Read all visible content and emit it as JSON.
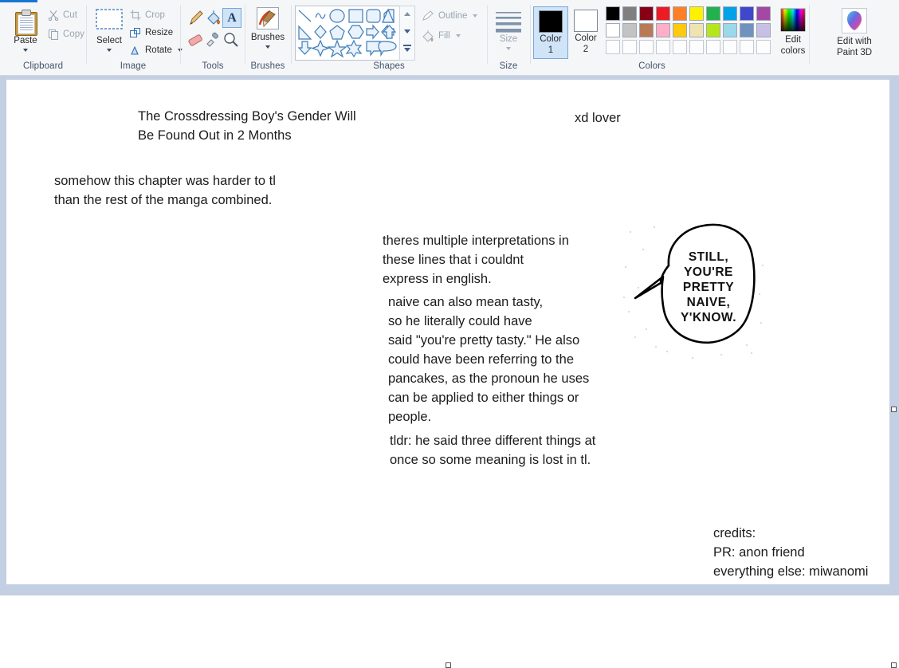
{
  "app": {
    "name": "Paint",
    "accent": "#1876d2"
  },
  "ribbon": {
    "groups": [
      {
        "id": "clipboard",
        "label": "Clipboard"
      },
      {
        "id": "image",
        "label": "Image"
      },
      {
        "id": "tools",
        "label": "Tools"
      },
      {
        "id": "brushes",
        "label": "Brushes"
      },
      {
        "id": "shapes",
        "label": "Shapes"
      },
      {
        "id": "size",
        "label": "Size"
      },
      {
        "id": "colors",
        "label": "Colors"
      }
    ],
    "clipboard": {
      "paste_label": "Paste",
      "cut_label": "Cut",
      "copy_label": "Copy"
    },
    "image": {
      "select_label": "Select",
      "crop_label": "Crop",
      "resize_label": "Resize",
      "rotate_label": "Rotate"
    },
    "brushes": {
      "label": "Brushes"
    },
    "shapes": {
      "outline_label": "Outline",
      "fill_label": "Fill"
    },
    "size": {
      "label": "Size"
    },
    "colors": {
      "color1_label": "Color\n1",
      "color1_line1": "Color",
      "color1_line2": "1",
      "color2_line1": "Color",
      "color2_line2": "2",
      "color1_value": "#000000",
      "color2_value": "#ffffff",
      "edit_colors_line1": "Edit",
      "edit_colors_line2": "colors",
      "paint3d_line1": "Edit with",
      "paint3d_line2": "Paint 3D",
      "palette_row1": [
        "#000000",
        "#7f7f7f",
        "#880015",
        "#ed1c24",
        "#ff7f27",
        "#fff200",
        "#22b14c",
        "#00a2e8",
        "#3f48cc",
        "#a349a4"
      ],
      "palette_row2": [
        "#ffffff",
        "#c3c3c3",
        "#b97a57",
        "#ffaec9",
        "#ffc90e",
        "#efe4b0",
        "#b5e61d",
        "#99d9ea",
        "#7092be",
        "#c8bfe7"
      ],
      "palette_row3": [
        "",
        "",
        "",
        "",
        "",
        "",
        "",
        "",
        "",
        ""
      ]
    }
  },
  "canvas": {
    "title_line1": "The Crossdressing Boy's Gender Will",
    "title_line2": "Be Found Out in 2 Months",
    "tag": "xd lover",
    "note_line1": "somehow this chapter was harder to tl",
    "note_line2": "than the rest of the manga combined.",
    "para1_line1": "theres multiple interpretations in",
    "para1_line2": "these lines that i couldnt",
    "para1_line3": "express in english.",
    "para2_line1": "naive can also mean tasty,",
    "para2_line2": "so he literally could have",
    "para2_line3": "said \"you're pretty tasty.\" He also",
    "para2_line4": "could have been referring to the",
    "para2_line5": "pancakes, as the pronoun he uses",
    "para2_line6": "can be applied to either things or",
    "para2_line7": "people.",
    "para3_line1": "tldr: he said three different things at",
    "para3_line2": "once so some meaning is lost in tl.",
    "bubble": {
      "line1": "STILL,",
      "line2": "YOU'RE",
      "line3": "PRETTY",
      "line4": "NAIVE,",
      "line5": "Y'KNOW."
    },
    "credits_line1": "credits:",
    "credits_line2": "PR: anon friend",
    "credits_line3": "everything else: miwanomi"
  }
}
